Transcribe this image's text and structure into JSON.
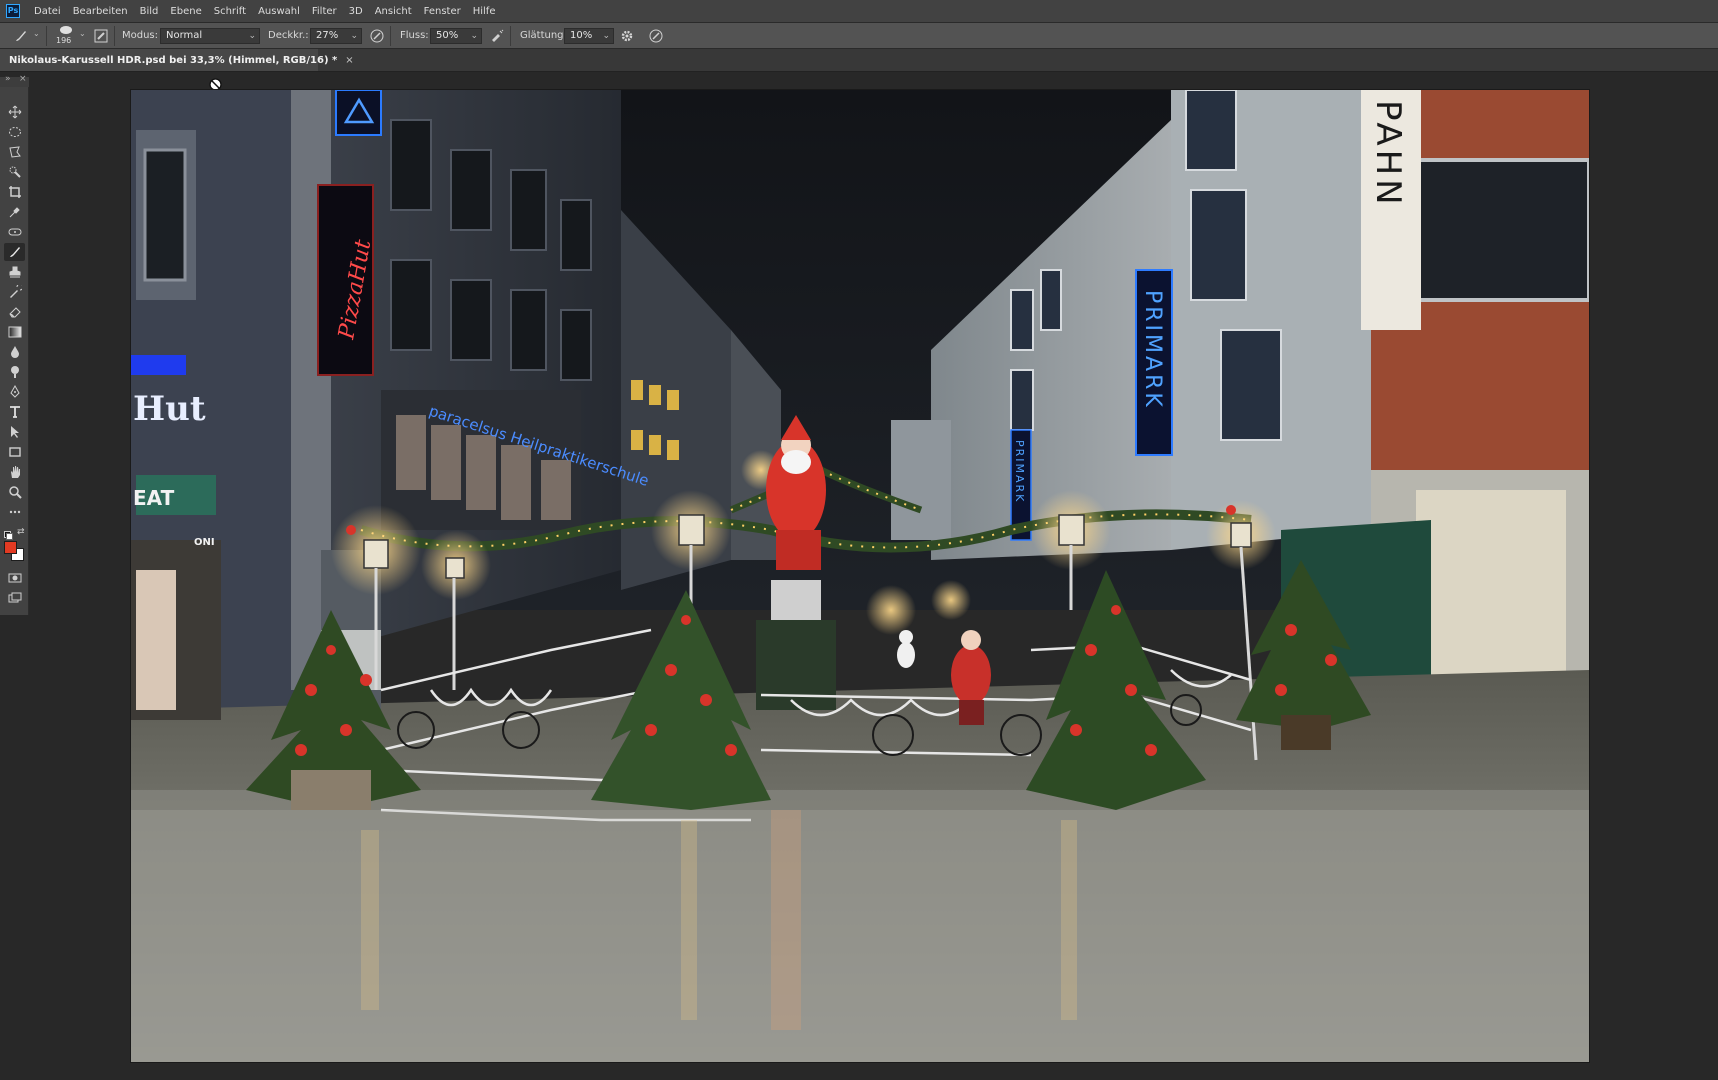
{
  "app": {
    "logo": "Ps"
  },
  "menu": [
    "Datei",
    "Bearbeiten",
    "Bild",
    "Ebene",
    "Schrift",
    "Auswahl",
    "Filter",
    "3D",
    "Ansicht",
    "Fenster",
    "Hilfe"
  ],
  "options": {
    "brush_size": "196",
    "mode_label": "Modus:",
    "mode_value": "Normal",
    "opacity_label": "Deckkr.:",
    "opacity_value": "27%",
    "flow_label": "Fluss:",
    "flow_value": "50%",
    "smoothing_label": "Glättung:",
    "smoothing_value": "10%"
  },
  "document_tab": {
    "title": "Nikolaus-Karussell HDR.psd bei 33,3% (Himmel, RGB/16) *",
    "close": "×"
  },
  "toolbox": {
    "tools": [
      "move-tool",
      "lasso-ellipse-tool",
      "polygon-lasso-tool",
      "quick-select-tool",
      "crop-tool",
      "eyedropper-tool",
      "healing-tool",
      "brush-tool",
      "stamp-tool",
      "history-brush-tool",
      "eraser-tool",
      "gradient-tool",
      "blur-tool",
      "dodge-tool",
      "pen-tool",
      "type-tool",
      "path-select-tool",
      "rectangle-tool",
      "hand-tool",
      "zoom-tool",
      "more-tools"
    ],
    "active_tool": "brush-tool",
    "foreground_color": "#e23a22",
    "background_color": "#ffffff"
  },
  "photo": {
    "signs": {
      "pizzahut": "PizzaHut",
      "paracelsus": "paracelsus Heilpraktikerschule",
      "primark_large": "PRIMARK",
      "primark_small": "PRIMARK",
      "pahn": "PAHN",
      "hut_partial": "Hut",
      "eat_partial": "EAT",
      "oni_partial": "ONI"
    }
  },
  "colors": {
    "ui_menubar": "#424242",
    "ui_optionsbar": "#535353",
    "ui_background": "#282828",
    "sign_blue": "#2b7bff",
    "santa_red": "#d8342a"
  }
}
